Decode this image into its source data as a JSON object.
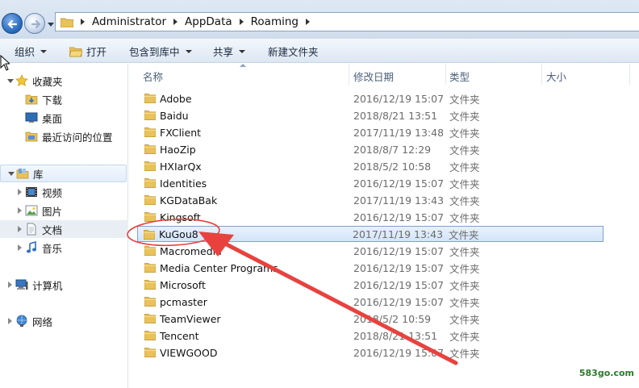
{
  "address": {
    "crumbs": [
      "Administrator",
      "AppData",
      "Roaming"
    ]
  },
  "toolbar": {
    "organize": "组织",
    "open": "打开",
    "include_library": "包含到库中",
    "share": "共享",
    "new_folder": "新建文件夹"
  },
  "nav": {
    "favorites": "收藏夹",
    "downloads": "下载",
    "desktop": "桌面",
    "recent": "最近访问的位置",
    "libraries": "库",
    "videos": "视频",
    "pictures": "图片",
    "documents": "文档",
    "music": "音乐",
    "computer": "计算机",
    "network": "网络"
  },
  "columns": {
    "name": "名称",
    "modified": "修改日期",
    "type": "类型",
    "size": "大小"
  },
  "files": [
    {
      "name": "Adobe",
      "date": "2016/12/19 15:07",
      "type": "文件夹"
    },
    {
      "name": "Baidu",
      "date": "2018/8/21 13:51",
      "type": "文件夹"
    },
    {
      "name": "FXClient",
      "date": "2017/11/19 13:48",
      "type": "文件夹"
    },
    {
      "name": "HaoZip",
      "date": "2018/8/7 12:29",
      "type": "文件夹"
    },
    {
      "name": "HXIarQx",
      "date": "2018/5/2 10:58",
      "type": "文件夹"
    },
    {
      "name": "Identities",
      "date": "2016/12/19 15:07",
      "type": "文件夹"
    },
    {
      "name": "KGDataBak",
      "date": "2017/11/19 13:43",
      "type": "文件夹"
    },
    {
      "name": "Kingsoft",
      "date": "2016/12/19 15:07",
      "type": "文件夹"
    },
    {
      "name": "KuGou8",
      "date": "2017/11/19 13:43",
      "type": "文件夹"
    },
    {
      "name": "Macromedia",
      "date": "2016/12/19 15:07",
      "type": "文件夹"
    },
    {
      "name": "Media Center Programs",
      "date": "2016/12/19 15:07",
      "type": "文件夹"
    },
    {
      "name": "Microsoft",
      "date": "2016/12/19 15:07",
      "type": "文件夹"
    },
    {
      "name": "pcmaster",
      "date": "2016/12/19 15:07",
      "type": "文件夹"
    },
    {
      "name": "TeamViewer",
      "date": "2018/5/2 10:59",
      "type": "文件夹"
    },
    {
      "name": "Tencent",
      "date": "2018/8/21 13:51",
      "type": "文件夹"
    },
    {
      "name": "VIEWGOOD",
      "date": "2016/12/19 15:07",
      "type": "文件夹"
    }
  ],
  "watermark": "583go.com",
  "colors": {
    "selection": "#d3e5fa",
    "annotation": "#e8423f",
    "folder": "#e9c25a"
  }
}
